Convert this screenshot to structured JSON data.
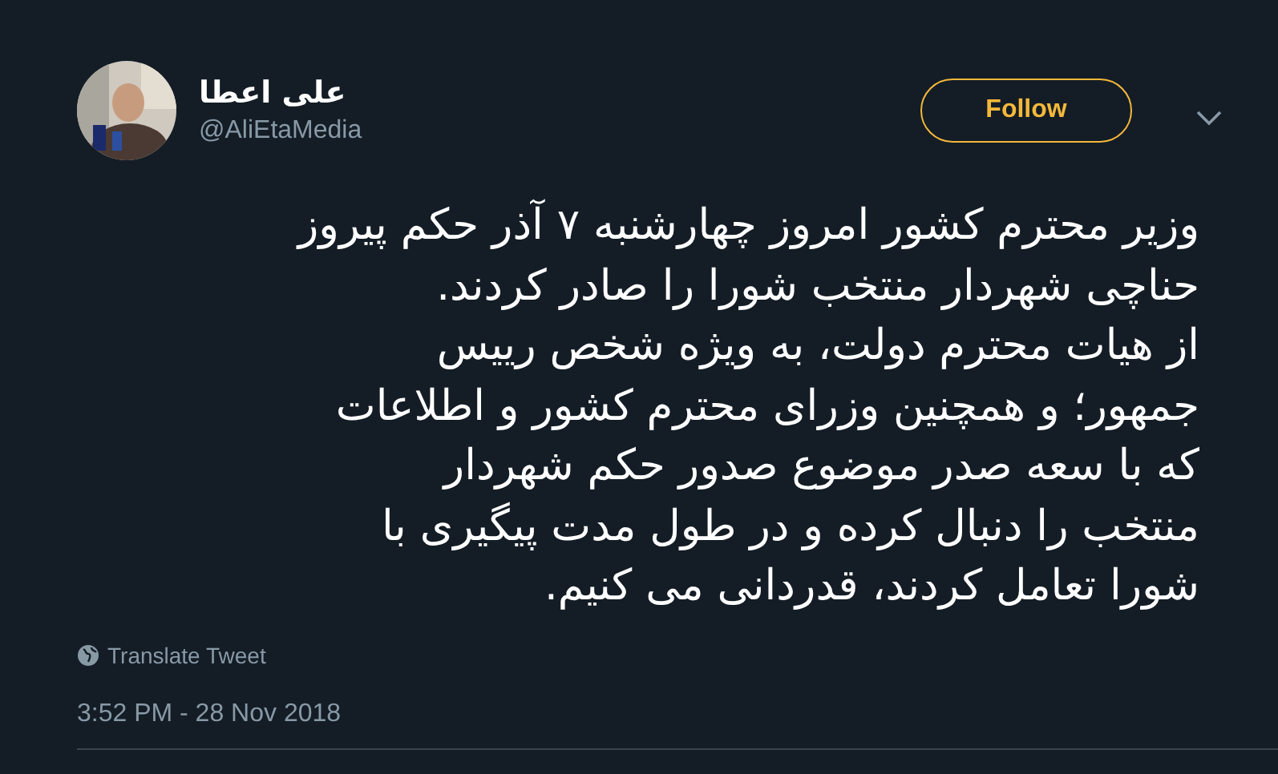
{
  "author": {
    "name": "علی اعطا",
    "handle": "@AliEtaMedia"
  },
  "follow_button": {
    "label": "Follow"
  },
  "tweet_lines": [
    "وزیر محترم کشور امروز چهارشنبه ۷ آذر حکم پیروز",
    "حناچی شهردار منتخب شورا را صادر کردند.",
    "از هیات محترم دولت، به ویژه شخص رییس",
    "جمهور؛ و همچنین وزرای محترم کشور و اطلاعات",
    "که با سعه صدر موضوع صدور حکم شهردار",
    "منتخب را دنبال کرده و در طول مدت پیگیری با",
    "شورا تعامل کردند، قدردانی می کنیم."
  ],
  "translate_link": "Translate Tweet",
  "timestamp": "3:52 PM - 28 Nov 2018"
}
